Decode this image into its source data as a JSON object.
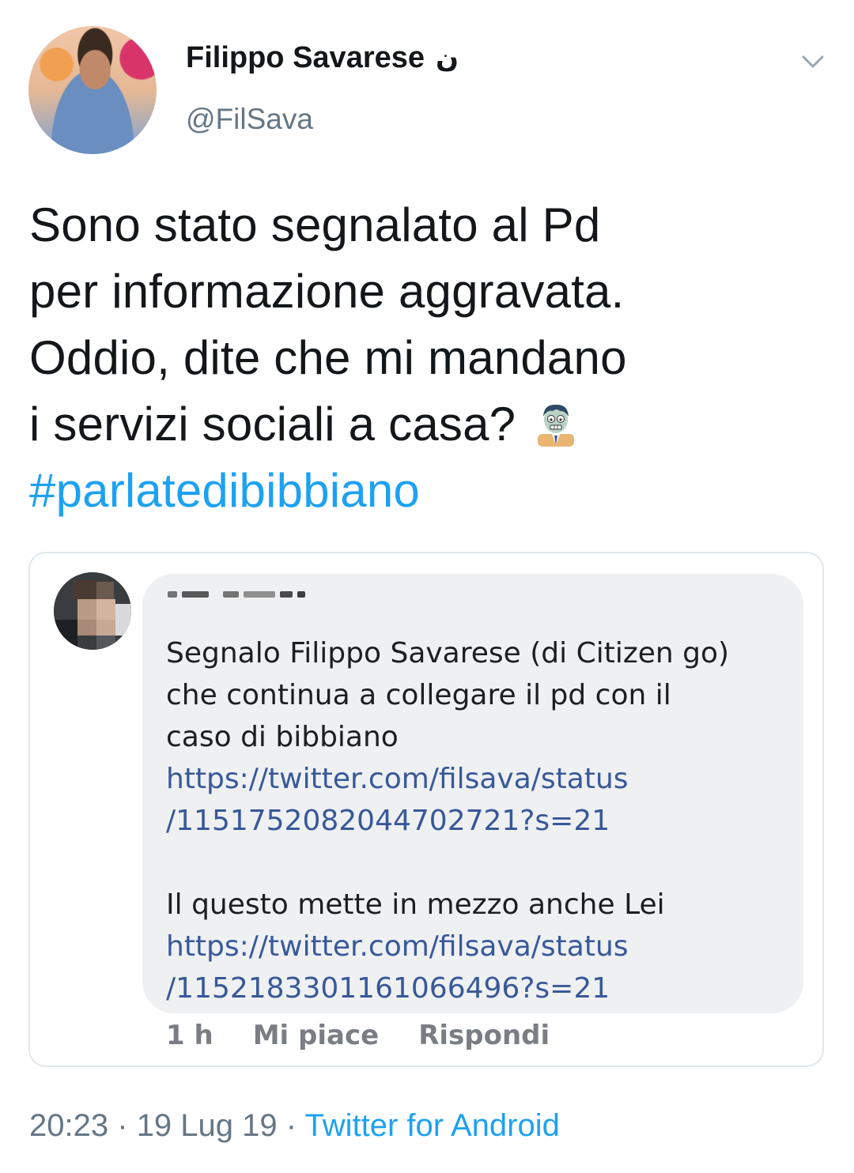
{
  "author": {
    "name": "Filippo Savarese",
    "name_glyph": "ن",
    "handle": "@FilSava"
  },
  "tweet": {
    "lines": [
      "Sono stato segnalato al Pd",
      "per informazione aggravata.",
      "Oddio, dite che mi mandano",
      "i servizi sociali a casa?"
    ],
    "emoji": "zombie",
    "hashtag": "#parlatedibibbiano"
  },
  "quoted_comment": {
    "lines": [
      "Segnalo Filippo Savarese (di Citizen go)",
      "che continua a collegare il pd con il",
      "caso di bibbiano"
    ],
    "link1": [
      "https://twitter.com/filsava/status",
      "/1151752082044702721?s=21"
    ],
    "line2": "Il questo mette in mezzo anche Lei",
    "link2": [
      "https://twitter.com/filsava/status",
      "/1152183301161066496?s=21"
    ],
    "time": "1 h",
    "like_label": "Mi piace",
    "reply_label": "Rispondi"
  },
  "footer": {
    "time": "20:23",
    "date": "19 Lug 19",
    "separator": "·",
    "source": "Twitter for Android"
  },
  "colors": {
    "link": "#1da1f2",
    "secondary": "#657786",
    "fb_link": "#385898",
    "bubble": "#eef0f2"
  }
}
